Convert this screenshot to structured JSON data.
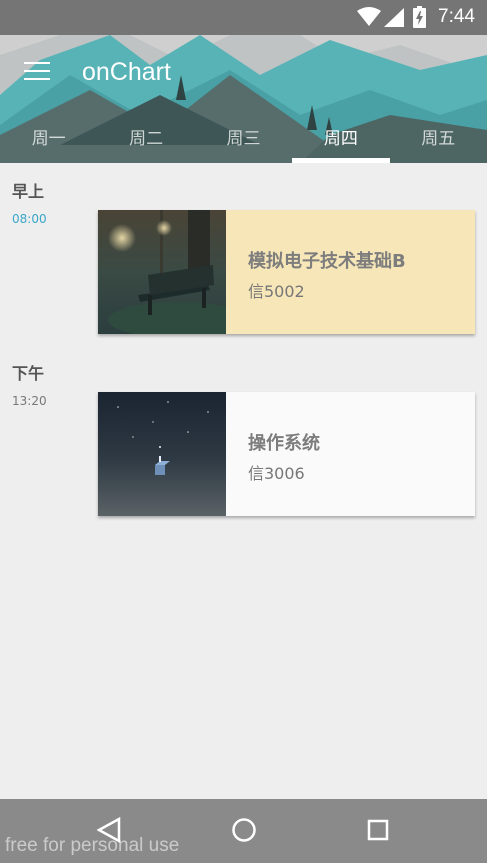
{
  "status_bar": {
    "time": "7:44"
  },
  "app": {
    "title": "onChart"
  },
  "tabs": [
    {
      "label": "周一"
    },
    {
      "label": "周二"
    },
    {
      "label": "周三"
    },
    {
      "label": "周四",
      "active": true
    },
    {
      "label": "周五"
    }
  ],
  "morning": {
    "heading": "早上",
    "time": "08:00",
    "course": {
      "name": "模拟电子技术基础B",
      "room": "信5002"
    }
  },
  "afternoon": {
    "heading": "下午",
    "time": "13:20",
    "course": {
      "name": "操作系统",
      "room": "信3006"
    }
  },
  "watermark": "free for personal use",
  "colors": {
    "accent": "#3aa6c9",
    "card_morning_bg": "#f7e6b8",
    "card_afternoon_bg": "#fafafa",
    "status_bar": "#757575",
    "nav_bar": "#8a8a8a"
  },
  "icons": {
    "menu": "menu-icon",
    "back": "back-triangle-icon",
    "home": "home-circle-icon",
    "recents": "recents-square-icon"
  }
}
